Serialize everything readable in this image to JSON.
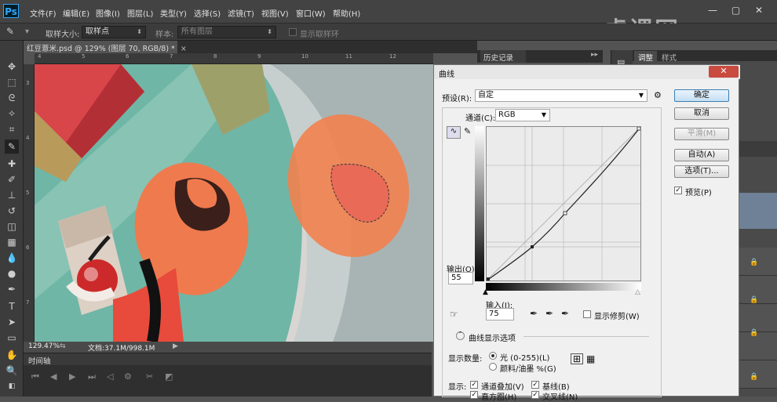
{
  "app": {
    "logo": "Ps"
  },
  "menu": [
    "文件(F)",
    "编辑(E)",
    "图像(I)",
    "图层(L)",
    "类型(Y)",
    "选择(S)",
    "滤镜(T)",
    "视图(V)",
    "窗口(W)",
    "帮助(H)"
  ],
  "options_bar": {
    "sample_size_label": "取样大小:",
    "sample_size_value": "取样点",
    "sample_label": "样本:",
    "sample_value": "所有图层",
    "show_ring_label": "显示取样环"
  },
  "document": {
    "tab_title": "红豆薏米.psd @ 129% (图层 70, RGB/8) *",
    "zoom": "129.47%",
    "doc_info": "文档:37.1M/998.1M",
    "ruler_top": [
      "4",
      "5",
      "6",
      "7",
      "8",
      "9",
      "10",
      "11",
      "12"
    ],
    "ruler_left": [
      "3",
      "4",
      "5",
      "6",
      "7"
    ]
  },
  "timeline": {
    "title": "时间轴"
  },
  "history_panel": {
    "title": "历史记录"
  },
  "right_panel": {
    "tabs": [
      "调整",
      "样式"
    ]
  },
  "curves_dialog": {
    "title": "曲线",
    "preset_label": "预设(R):",
    "preset_value": "自定",
    "channel_label": "通道(C):",
    "channel_value": "RGB",
    "output_label": "输出(O):",
    "output_value": "55",
    "input_label": "输入(I):",
    "input_value": "75",
    "show_clipping_label": "显示修剪(W)",
    "curve_options_label": "曲线显示选项",
    "show_amount_label": "显示数量:",
    "light_label": "光 (0-255)(L)",
    "pigment_label": "颜料/油墨 %(G)",
    "show_label": "显示:",
    "channel_overlay_label": "通道叠加(V)",
    "baseline_label": "基线(B)",
    "histogram_label": "直方图(H)",
    "intersection_label": "交叉线(N)",
    "buttons": {
      "ok": "确定",
      "cancel": "取消",
      "smooth": "平滑(M)",
      "auto": "自动(A)",
      "options": "选项(T)..."
    },
    "preview_label": "预览(P)"
  },
  "watermark": "虎课网"
}
